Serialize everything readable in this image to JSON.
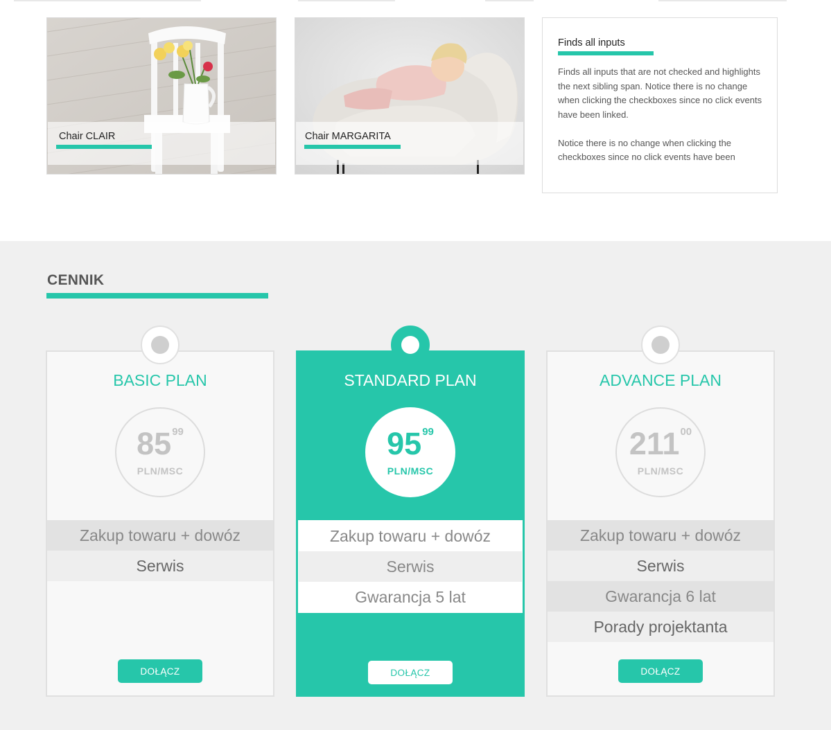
{
  "gallery": [
    {
      "label": "Chair CLAIR"
    },
    {
      "label": "Chair MARGARITA"
    }
  ],
  "info": {
    "title": "Finds all inputs",
    "paragraphs": [
      "Finds all inputs that are not checked and highlights the next sibling span. Notice there is no change when clicking the checkboxes since no click events have been linked.",
      "Notice there is no change when clicking the checkboxes since no click events have been"
    ]
  },
  "pricing": {
    "title": "CENNIK",
    "plans": [
      {
        "name": "BASIC PLAN",
        "price": "85",
        "cents": "99",
        "unit": "PLN/MSC",
        "features": [
          "Zakup towaru + dowóz",
          "Serwis"
        ],
        "button": "DOŁĄCZ"
      },
      {
        "name": "STANDARD PLAN",
        "price": "95",
        "cents": "99",
        "unit": "PLN/MSC",
        "features": [
          "Zakup towaru + dowóz",
          "Serwis",
          "Gwarancja 5 lat"
        ],
        "button": "DOŁĄCZ"
      },
      {
        "name": "ADVANCE PLAN",
        "price": "211",
        "cents": "00",
        "unit": "PLN/MSC",
        "features": [
          "Zakup towaru + dowóz",
          "Serwis",
          "Gwarancja 6 lat",
          "Porady projektanta"
        ],
        "button": "DOŁĄCZ"
      }
    ]
  },
  "colors": {
    "accent": "#26c6aa",
    "section_bg": "#f0f0f0",
    "card_bg": "#f8f8f8"
  }
}
